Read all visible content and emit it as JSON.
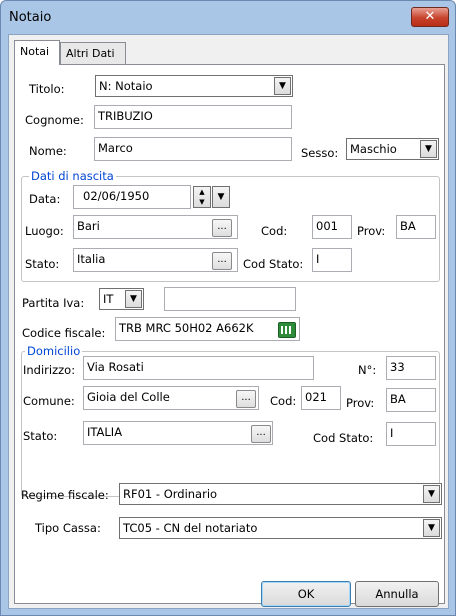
{
  "window": {
    "title": "Notaio",
    "close_glyph": "✕"
  },
  "tabs": [
    {
      "label": "Notai"
    },
    {
      "label": "Altri Dati"
    }
  ],
  "form": {
    "titolo": {
      "label": "Titolo:",
      "value": "N: Notaio"
    },
    "cognome": {
      "label": "Cognome:",
      "value": "TRIBUZIO"
    },
    "nome": {
      "label": "Nome:",
      "value": "Marco"
    },
    "sesso": {
      "label": "Sesso:",
      "value": "Maschio"
    },
    "nascita": {
      "group_title": "Dati di nascita",
      "data": {
        "label": "Data:",
        "value": "02/06/1950"
      },
      "luogo": {
        "label": "Luogo:",
        "value": "Bari"
      },
      "cod": {
        "label": "Cod:",
        "value": "001"
      },
      "prov": {
        "label": "Prov:",
        "value": "BA"
      },
      "stato": {
        "label": "Stato:",
        "value": "Italia"
      },
      "cod_stato": {
        "label": "Cod Stato:",
        "value": "I"
      }
    },
    "partita_iva": {
      "label": "Partita Iva:",
      "country": "IT",
      "value": ""
    },
    "codice_fiscale": {
      "label": "Codice fiscale:",
      "value": "TRB MRC 50H02 A662K"
    },
    "domicilio": {
      "group_title": "Domicilio",
      "indirizzo": {
        "label": "Indirizzo:",
        "value": "Via Rosati"
      },
      "numero": {
        "label": "N°:",
        "value": "33"
      },
      "comune": {
        "label": "Comune:",
        "value": "Gioia del Colle"
      },
      "cod": {
        "label": "Cod:",
        "value": "021"
      },
      "prov": {
        "label": "Prov:",
        "value": "BA"
      },
      "stato": {
        "label": "Stato:",
        "value": "ITALIA"
      },
      "cod_stato": {
        "label": "Cod Stato:",
        "value": "I"
      }
    },
    "regime_fiscale": {
      "label": "Regime fiscale:",
      "value": "RF01 - Ordinario"
    },
    "tipo_cassa": {
      "label": "Tipo Cassa:",
      "value": "TC05 - CN del notariato"
    }
  },
  "buttons": {
    "ok": "OK",
    "annulla": "Annulla"
  },
  "glyphs": {
    "dropdown": "▼",
    "ellipsis": "...",
    "spin_up": "▲",
    "spin_down": "▼"
  }
}
